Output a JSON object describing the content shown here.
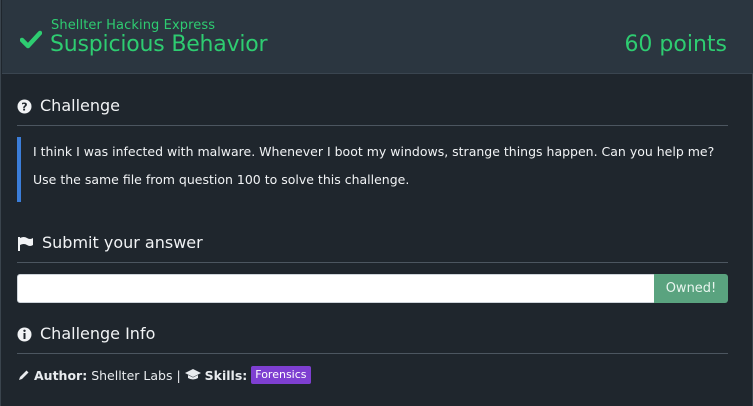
{
  "header": {
    "subtitle": "Shellter Hacking Express",
    "title": "Suspicious Behavior",
    "points": "60 points",
    "status_icon": "check-icon",
    "accent_color": "#2ecc71"
  },
  "challenge": {
    "heading": "Challenge",
    "icon": "question-circle-icon",
    "lines": [
      "I think I was infected with malware. Whenever I boot my windows, strange things happen. Can you help me?",
      "Use the same file from question 100 to solve this challenge."
    ]
  },
  "submit": {
    "heading": "Submit your answer",
    "icon": "flag-icon",
    "input_value": "",
    "input_placeholder": "",
    "button_label": "Owned!"
  },
  "info": {
    "heading": "Challenge Info",
    "icon": "info-circle-icon",
    "author_label": "Author:",
    "author_value": "Shellter Labs",
    "separator": "|",
    "skills_label": "Skills:",
    "skills": [
      "Forensics"
    ]
  }
}
